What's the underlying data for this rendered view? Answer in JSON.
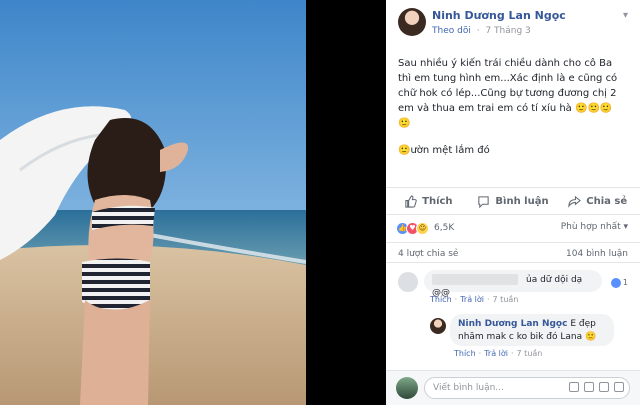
{
  "post": {
    "author": "Ninh Dương Lan Ngọc",
    "follow": "Theo dõi",
    "dot": "·",
    "date": "7 Tháng 3",
    "caption": "Sau nhiều ý kiến trái chiều dành cho cô Ba thì em tung hình em...Xác định là e cũng có chữ hok có lép...Cũng bự tương đương chị 2 em và thua em trai em có tí xíu hà 🙂🙂🙂🙂",
    "caption2": "🙂ườn mệt lắm đó"
  },
  "actions": {
    "like": "Thích",
    "comment": "Bình luận",
    "share": "Chia sẻ"
  },
  "stats": {
    "reaction_count": "6,5K",
    "sort_label": "Phù hợp nhất ▾",
    "shares": "4 lượt chia sẻ",
    "comments": "104 bình luận"
  },
  "comments": [
    {
      "text": "ủa dữ dội dạ @@",
      "like_label": "Thích",
      "reply_label": "Trả lời",
      "time": "7 tuần",
      "likes": "1"
    },
    {
      "name": "Ninh Dương Lan Ngọc",
      "text": "E đẹp nhăm mak c ko bik đó Lana 🙂",
      "like_label": "Thích",
      "reply_label": "Trả lời",
      "time": "7 tuần"
    }
  ],
  "composer": {
    "placeholder": "Viết bình luận..."
  },
  "icons": {
    "more": "chevron-down-icon",
    "like": "thumbs-up-icon",
    "comment": "speech-bubble-icon",
    "share": "share-arrow-icon"
  }
}
